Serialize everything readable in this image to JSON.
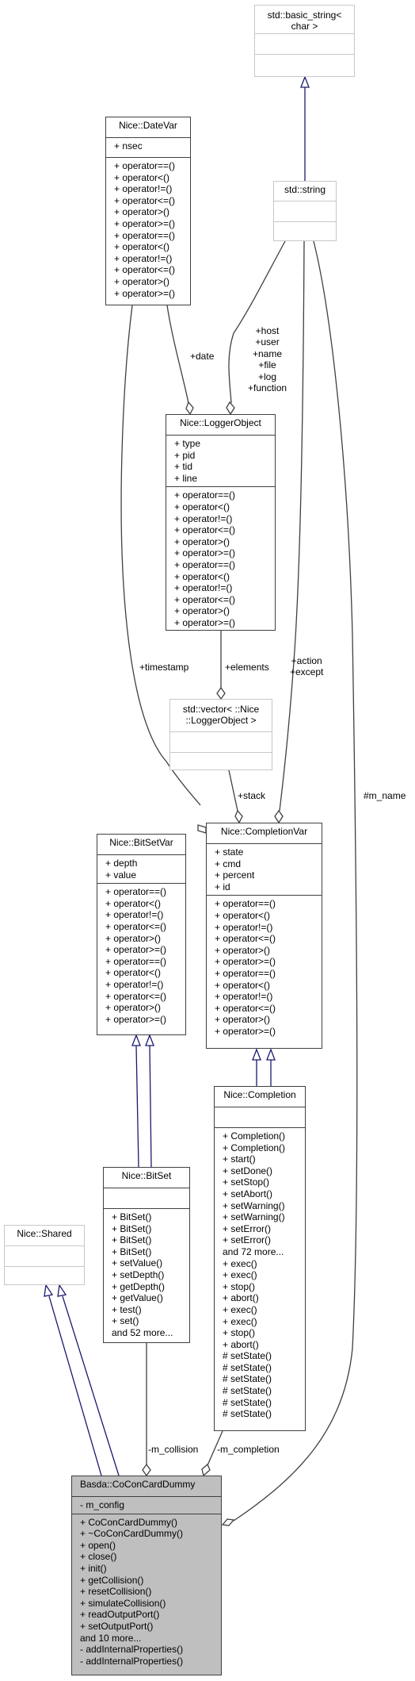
{
  "diagram": {
    "type": "uml-collaboration",
    "classes": {
      "basic_string": {
        "name": "std::basic_string<\nchar >",
        "name_line1": "std::basic_string<",
        "name_line2": "char >",
        "attributes": [],
        "methods": []
      },
      "string": {
        "name": "std::string",
        "attributes": [],
        "methods": []
      },
      "datevar": {
        "name": "Nice::DateVar",
        "attributes": [
          "+ nsec"
        ],
        "methods": [
          "+ operator==()",
          "+ operator<()",
          "+ operator!=()",
          "+ operator<=()",
          "+ operator>()",
          "+ operator>=()",
          "+ operator==()",
          "+ operator<()",
          "+ operator!=()",
          "+ operator<=()",
          "+ operator>()",
          "+ operator>=()"
        ]
      },
      "loggerobject": {
        "name": "Nice::LoggerObject",
        "attributes": [
          "+ type",
          "+ pid",
          "+ tid",
          "+ line"
        ],
        "methods": [
          "+ operator==()",
          "+ operator<()",
          "+ operator!=()",
          "+ operator<=()",
          "+ operator>()",
          "+ operator>=()",
          "+ operator==()",
          "+ operator<()",
          "+ operator!=()",
          "+ operator<=()",
          "+ operator>()",
          "+ operator>=()"
        ]
      },
      "vector": {
        "name_line1": "std::vector< ::Nice",
        "name_line2": "::LoggerObject >",
        "attributes": [],
        "methods": []
      },
      "completionvar": {
        "name": "Nice::CompletionVar",
        "attributes": [
          "+ state",
          "+ cmd",
          "+ percent",
          "+ id"
        ],
        "methods": [
          "+ operator==()",
          "+ operator<()",
          "+ operator!=()",
          "+ operator<=()",
          "+ operator>()",
          "+ operator>=()",
          "+ operator==()",
          "+ operator<()",
          "+ operator!=()",
          "+ operator<=()",
          "+ operator>()",
          "+ operator>=()"
        ]
      },
      "bitsetvar": {
        "name": "Nice::BitSetVar",
        "attributes": [
          "+ depth",
          "+ value"
        ],
        "methods": [
          "+ operator==()",
          "+ operator<()",
          "+ operator!=()",
          "+ operator<=()",
          "+ operator>()",
          "+ operator>=()",
          "+ operator==()",
          "+ operator<()",
          "+ operator!=()",
          "+ operator<=()",
          "+ operator>()",
          "+ operator>=()"
        ]
      },
      "completion": {
        "name": "Nice::Completion",
        "attributes": [],
        "methods": [
          "+ Completion()",
          "+ Completion()",
          "+ start()",
          "+ setDone()",
          "+ setStop()",
          "+ setAbort()",
          "+ setWarning()",
          "+ setWarning()",
          "+ setError()",
          "+ setError()",
          "and 72 more...",
          "+ exec()",
          "+ exec()",
          "+ stop()",
          "+ abort()",
          "+ exec()",
          "+ exec()",
          "+ stop()",
          "+ abort()",
          "# setState()",
          "# setState()",
          "# setState()",
          "# setState()",
          "# setState()",
          "# setState()"
        ]
      },
      "bitset": {
        "name": "Nice::BitSet",
        "attributes": [],
        "methods": [
          "+ BitSet()",
          "+ BitSet()",
          "+ BitSet()",
          "+ BitSet()",
          "+ setValue()",
          "+ setDepth()",
          "+ getDepth()",
          "+ getValue()",
          "+ test()",
          "+ set()",
          "and 52 more..."
        ]
      },
      "shared": {
        "name": "Nice::Shared",
        "attributes": [],
        "methods": []
      },
      "coconcarddummy": {
        "name": "Basda::CoConCardDummy",
        "attributes": [
          "- m_config"
        ],
        "methods": [
          "+ CoConCardDummy()",
          "+ ~CoConCardDummy()",
          "+ open()",
          "+ close()",
          "+ init()",
          "+ getCollision()",
          "+ resetCollision()",
          "+ simulateCollision()",
          "+ readOutputPort()",
          "+ setOutputPort()",
          "and 10 more...",
          "- addInternalProperties()",
          "- addInternalProperties()"
        ]
      }
    },
    "edge_labels": {
      "date": "+date",
      "string_logger": [
        "+host",
        "+user",
        "+name",
        "+file",
        "+log",
        "+function"
      ],
      "timestamp": "+timestamp",
      "elements": "+elements",
      "action_except": [
        "+action",
        "+except"
      ],
      "m_name": "#m_name",
      "stack": "+stack",
      "m_collision": "-m_collision",
      "m_completion": "-m_completion"
    },
    "colors": {
      "inheritance_edge": "#191970",
      "usage_edge": "#404040",
      "external_border": "#c8c8c8",
      "focus_fill": "#bfbfbf"
    }
  }
}
